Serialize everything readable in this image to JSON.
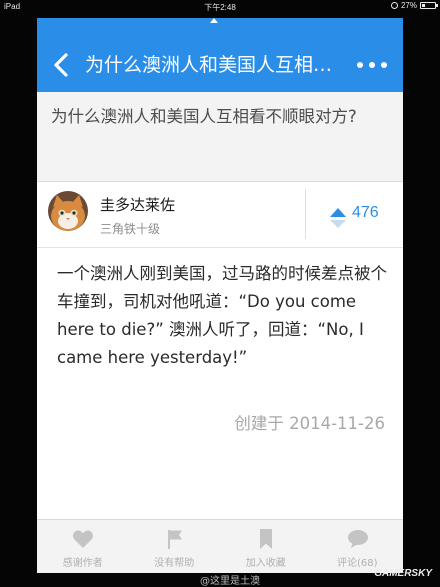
{
  "status_bar": {
    "carrier": "iPad",
    "time": "下午2:48",
    "battery": "27%",
    "battery_level": 0.27
  },
  "nav": {
    "title": "为什么澳洲人和美国人互相…"
  },
  "question": {
    "title": "为什么澳洲人和美国人互相看不顺眼对方?"
  },
  "author": {
    "name": "圭多达莱佐",
    "title": "三角铁十级",
    "votes": "476"
  },
  "answer": {
    "body": "一个澳洲人刚到美国，过马路的时候差点被个车撞到，司机对他吼道：“Do you come here to die?” 澳洲人听了，回道：“No, I came here yesterday!”",
    "created": "创建于 2014-11-26"
  },
  "tabs": [
    {
      "label": "感谢作者",
      "icon": "heart-icon"
    },
    {
      "label": "没有帮助",
      "icon": "flag-icon"
    },
    {
      "label": "加入收藏",
      "icon": "bookmark-icon"
    },
    {
      "label": "评论(68)",
      "icon": "comment-icon"
    }
  ],
  "watermark": {
    "source": "@这里是土澳",
    "brand": "GAMERSKY"
  },
  "colors": {
    "accent": "#2a8ee8",
    "tab_icon": "#c4c4c4"
  }
}
